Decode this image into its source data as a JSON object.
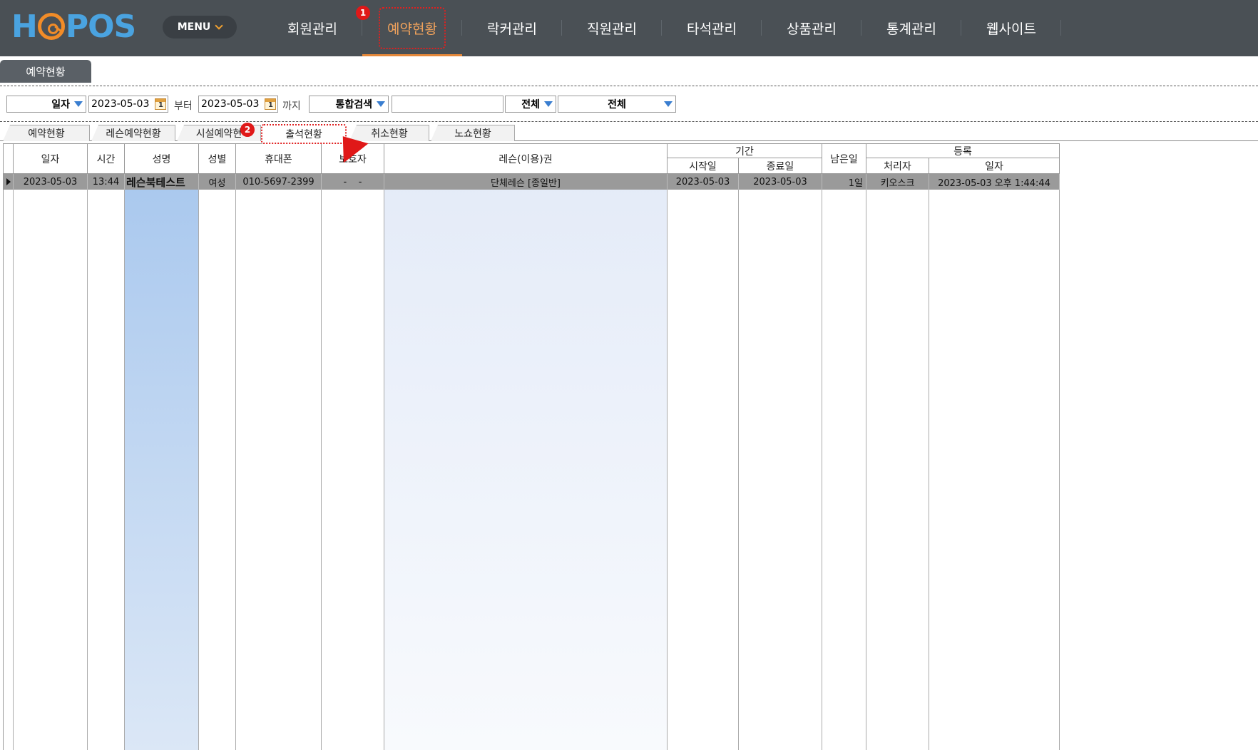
{
  "app": {
    "logo_left": "H",
    "logo_right": "POS",
    "menu_label": "MENU",
    "nav": [
      "회원관리",
      "예약현황",
      "락커관리",
      "직원관리",
      "타석관리",
      "상품관리",
      "통계관리",
      "웹사이트"
    ],
    "badge1": "1",
    "badge2": "2"
  },
  "page_tab": "예약현황",
  "filters": {
    "date_type": "일자",
    "from_date": "2023-05-03",
    "from_label": "부터",
    "to_date": "2023-05-03",
    "to_label": "까지",
    "search_type": "통합검색",
    "search_value": "",
    "filter1": "전체",
    "filter2": "전체"
  },
  "subtabs": [
    "예약현황",
    "레슨예약현황",
    "시설예약현",
    "출석현황",
    "취소현황",
    "노쇼현황"
  ],
  "table": {
    "headers": {
      "date": "일자",
      "time": "시간",
      "name": "성명",
      "gender": "성별",
      "phone": "휴대폰",
      "guardian": "보호자",
      "pass": "레슨(이용)권",
      "period": "기간",
      "start": "시작일",
      "end": "종료일",
      "remain": "남은일",
      "reg": "등록",
      "handler": "처리자",
      "reg_date": "일자"
    },
    "rows": [
      {
        "date": "2023-05-03",
        "time": "13:44",
        "name": "레슨북테스트",
        "gender": "여성",
        "phone": "010-5697-2399",
        "guardian": "-    -",
        "pass": "단체레슨 [종일반]",
        "start": "2023-05-03",
        "end": "2023-05-03",
        "remain": "1일",
        "handler": "키오스크",
        "reg_date": "2023-05-03 오후 1:44:44"
      }
    ]
  },
  "colors": {
    "topbar": "#4a5055",
    "accent": "#f2a35c",
    "highlight_red": "#e02020",
    "logo_blue": "#4aa3e0",
    "row_selected": "#9a9a9a"
  }
}
